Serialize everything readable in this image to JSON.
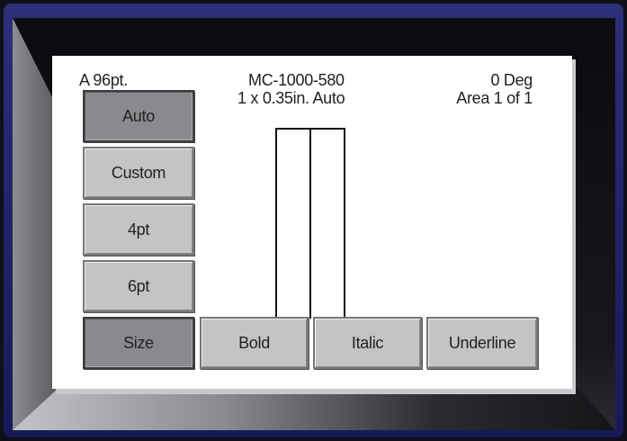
{
  "header": {
    "font_size": "A 96pt.",
    "cartridge": "MC-1000-580",
    "label_size": "1 x 0.35in.  Auto",
    "rotation": "0 Deg",
    "area": "Area  1 of 1"
  },
  "size_options": [
    {
      "label": "Auto",
      "selected": true
    },
    {
      "label": "Custom",
      "selected": false
    },
    {
      "label": "4pt",
      "selected": false
    },
    {
      "label": "6pt",
      "selected": false
    }
  ],
  "toolbar": {
    "size_label": "Size",
    "bold_label": "Bold",
    "italic_label": "Italic",
    "underline_label": "Underline",
    "size_active": true
  },
  "colors": {
    "bezel_blue": "#20246a",
    "button_face": "#c4c4c6",
    "button_active": "#8a8a8e"
  }
}
